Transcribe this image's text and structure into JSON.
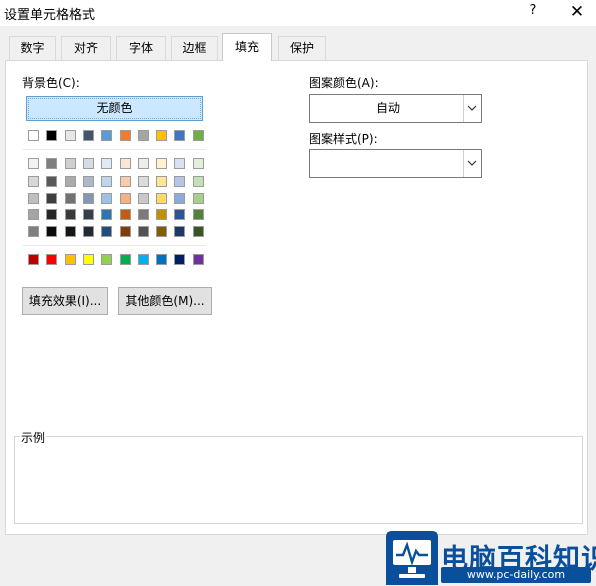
{
  "window": {
    "title": "设置单元格格式",
    "help": "?",
    "close": "✕"
  },
  "tabs": [
    {
      "label": "数字",
      "active": false
    },
    {
      "label": "对齐",
      "active": false
    },
    {
      "label": "字体",
      "active": false
    },
    {
      "label": "边框",
      "active": false
    },
    {
      "label": "填充",
      "active": true
    },
    {
      "label": "保护",
      "active": false
    }
  ],
  "background": {
    "label": "背景色(C):",
    "no_color_label": "无颜色",
    "theme_top_row": [
      "#ffffff",
      "#000000",
      "#e7e6e6",
      "#44546a",
      "#5b9bd5",
      "#ed7d31",
      "#a5a5a5",
      "#ffc000",
      "#4472c4",
      "#70ad47"
    ],
    "theme_shades": [
      [
        "#f2f2f2",
        "#7f7f7f",
        "#d0cece",
        "#d6dce4",
        "#deebf6",
        "#fbe5d5",
        "#ededed",
        "#fff2cc",
        "#d9e2f3",
        "#e2efd9"
      ],
      [
        "#d8d8d8",
        "#595959",
        "#aeaaaa",
        "#adb9ca",
        "#bdd7ee",
        "#f7cbac",
        "#dbdbdb",
        "#fee599",
        "#b4c6e7",
        "#c5e0b3"
      ],
      [
        "#bfbfbf",
        "#3f3f3f",
        "#757070",
        "#8496b0",
        "#9cc3e5",
        "#f4b183",
        "#c9c9c9",
        "#ffd965",
        "#8eaadb",
        "#a8d08d"
      ],
      [
        "#a5a5a5",
        "#262626",
        "#3a3838",
        "#323f4f",
        "#2e75b5",
        "#c55a11",
        "#7b7b7b",
        "#bf9000",
        "#2f5496",
        "#538135"
      ],
      [
        "#7f7f7f",
        "#0c0c0c",
        "#171616",
        "#222a35",
        "#1e4e79",
        "#833c0b",
        "#525252",
        "#7f6000",
        "#1f3864",
        "#375623"
      ]
    ],
    "standard": [
      "#c00000",
      "#ff0000",
      "#ffc000",
      "#ffff00",
      "#92d050",
      "#00b050",
      "#00b0f0",
      "#0070c0",
      "#002060",
      "#7030a0"
    ]
  },
  "buttons": {
    "fill_effects": "填充效果(I)...",
    "more_colors": "其他颜色(M)..."
  },
  "pattern": {
    "color_label": "图案颜色(A):",
    "color_value": "自动",
    "style_label": "图案样式(P):",
    "style_value": ""
  },
  "sample": {
    "label": "示例"
  },
  "watermark": {
    "title": "电脑百科知识",
    "url": "www.pc-daily.com",
    "brand_color": "#0a4f9c"
  }
}
